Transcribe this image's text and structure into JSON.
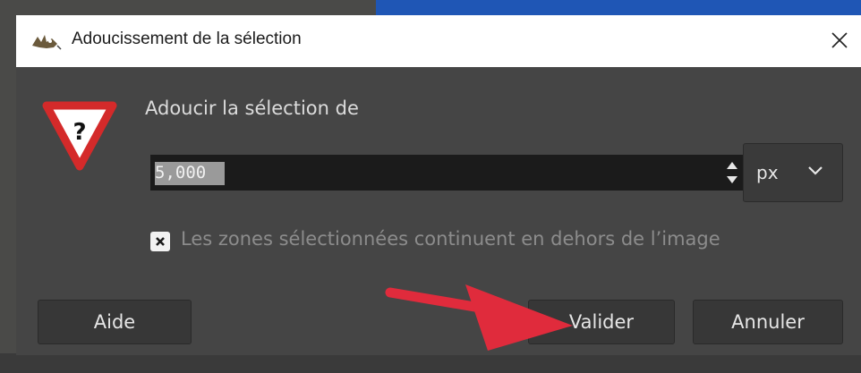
{
  "window": {
    "title": "Adoucissement de la sélection",
    "close_icon": "close-icon",
    "app_icon": "gimp-wilber-icon"
  },
  "dialog": {
    "prompt_icon": "question-warning-icon",
    "prompt_label": "Adoucir la sélection de",
    "radius": {
      "value": "5,000",
      "unit": "px"
    },
    "checkbox": {
      "checked": true,
      "label": "Les zones sélectionnées continuent en dehors de l’image"
    }
  },
  "buttons": {
    "help": "Aide",
    "ok": "Valider",
    "cancel": "Annuler"
  },
  "colors": {
    "dialog_bg": "#454545",
    "titlebar_bg": "#ffffff",
    "field_bg": "#1b1b1b",
    "annotation_arrow": "#e02b3c",
    "desktop_blue": "#1f56b5"
  },
  "annotation": {
    "type": "arrow",
    "points_to": "ok-button"
  }
}
